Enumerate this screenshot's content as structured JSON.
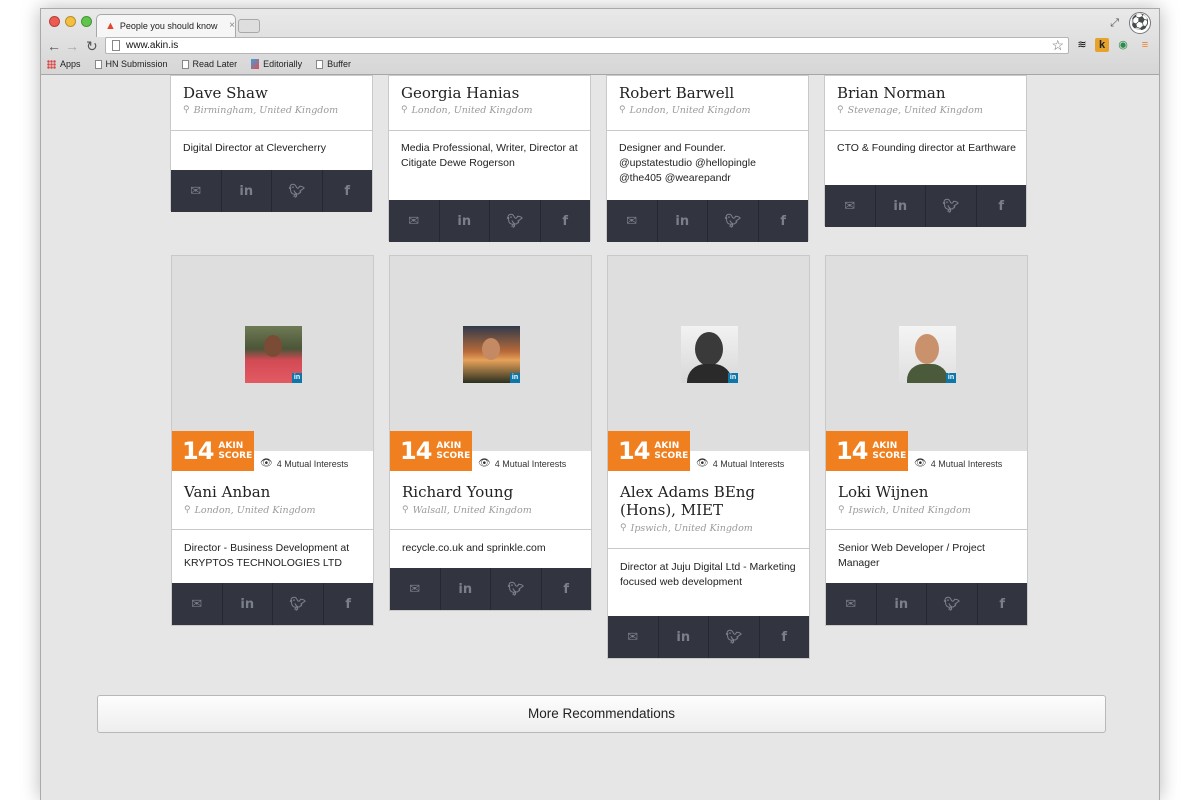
{
  "browser": {
    "tab_title": "People you should know",
    "url": "www.akin.is",
    "bookmarks": [
      "Apps",
      "HN Submission",
      "Read Later",
      "Editorially",
      "Buffer"
    ]
  },
  "colors": {
    "accent": "#f0801f",
    "social_bar": "#323540",
    "page_bg": "#e6e6e6"
  },
  "top_cards": [
    {
      "name": "Dave Shaw",
      "location": "Birmingham, United Kingdom",
      "bio": "Digital Director at Clevercherry"
    },
    {
      "name": "Georgia Hanias",
      "location": "London, United Kingdom",
      "bio": "Media Professional, Writer, Director at Citigate Dewe Rogerson"
    },
    {
      "name": "Robert Barwell",
      "location": "London, United Kingdom",
      "bio": "Designer and Founder. @upstatestudio @hellopingle @the405 @wearepandr"
    },
    {
      "name": "Brian Norman",
      "location": "Stevenage, United Kingdom",
      "bio": "CTO & Founding director at Earthware"
    }
  ],
  "cards": [
    {
      "name": "Vani Anban",
      "location": "London, United Kingdom",
      "bio": "Director - Business Development at KRYPTOS TECHNOLOGIES LTD",
      "score": "14",
      "mutual": "4 Mutual Interests"
    },
    {
      "name": "Richard Young",
      "location": "Walsall, United Kingdom",
      "bio": "recycle.co.uk and sprinkle.com",
      "score": "14",
      "mutual": "4 Mutual Interests"
    },
    {
      "name": "Alex Adams BEng (Hons), MIET",
      "location": "Ipswich, United Kingdom",
      "bio": "Director at Juju Digital Ltd - Marketing focused web development",
      "score": "14",
      "mutual": "4 Mutual Interests"
    },
    {
      "name": "Loki Wijnen",
      "location": "Ipswich, United Kingdom",
      "bio": "Senior Web Developer / Project Manager",
      "score": "14",
      "mutual": "4 Mutual Interests"
    }
  ],
  "score_label": "AKIN\nSCORE",
  "social_icons": [
    "mail-icon",
    "linkedin-icon",
    "twitter-icon",
    "facebook-icon"
  ],
  "more_button": "More Recommendations"
}
